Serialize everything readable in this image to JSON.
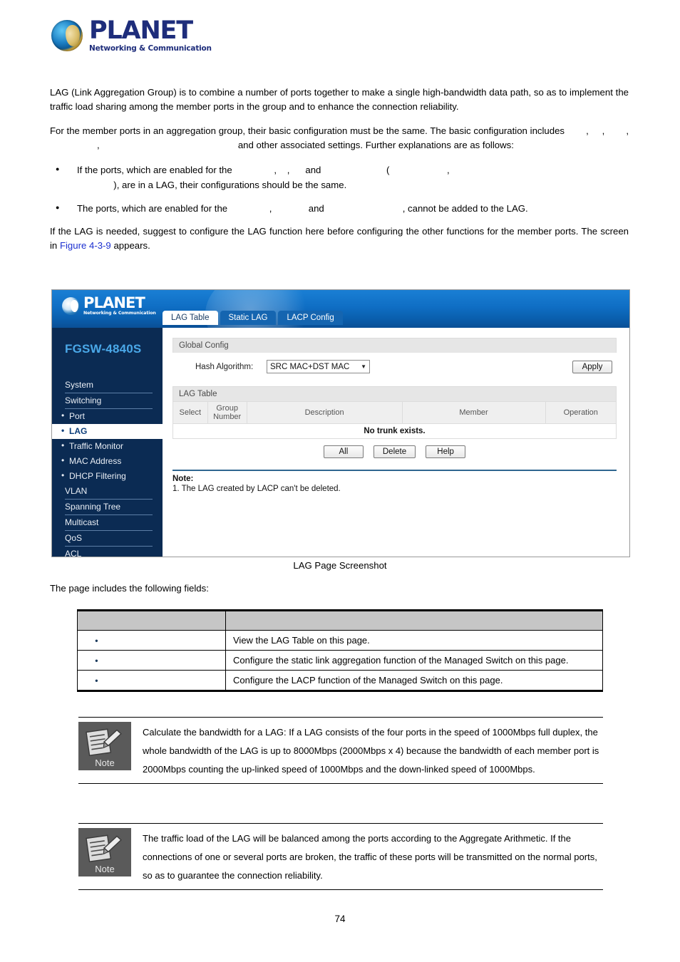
{
  "brand": {
    "name": "PLANET",
    "tagline": "Networking & Communication"
  },
  "intro": {
    "para1": "LAG (Link Aggregation Group) is to combine a number of ports together to make a single high-bandwidth data path, so as to implement the traffic load sharing among the member ports in the group and to enhance the connection reliability.",
    "para2_a": "For the member ports in an aggregation group, their basic configuration must be the same. The basic configuration includes",
    "para2_sep1": ",",
    "para2_sep2": ",",
    "para2_sep3": ",",
    "para2_sep4": ",",
    "para2_b": "and other associated settings. Further explanations are as follows:",
    "bullet1_a": "If the ports, which are enabled for the",
    "bullet1_sep1": ",",
    "bullet1_sep2": ",",
    "bullet1_and": "and",
    "bullet1_paren_open": "(",
    "bullet1_sep3": ",",
    "bullet1_paren_close": "),",
    "bullet1_b": "are in a LAG, their configurations should be the same.",
    "bullet2_a": "The ports, which are enabled for the",
    "bullet2_sep1": ",",
    "bullet2_and": "and",
    "bullet2_sep2": ",",
    "bullet2_b": "cannot be added to the LAG.",
    "para3_a": "If the LAG is needed, suggest to configure the LAG function here before configuring the other functions for the member ports. The screen in",
    "para3_link": "Figure 4-3-9",
    "para3_b": "appears."
  },
  "screenshot": {
    "model": "FGSW-4840S",
    "tabs": [
      {
        "label": "LAG Table",
        "active": true
      },
      {
        "label": "Static LAG",
        "active": false
      },
      {
        "label": "LACP Config",
        "active": false
      }
    ],
    "sidebar": [
      {
        "label": "System",
        "type": "top",
        "active": false
      },
      {
        "label": "Switching",
        "type": "top",
        "active": false
      },
      {
        "label": "Port",
        "type": "sub",
        "active": false
      },
      {
        "label": "LAG",
        "type": "sub",
        "active": true
      },
      {
        "label": "Traffic Monitor",
        "type": "sub",
        "active": false
      },
      {
        "label": "MAC Address",
        "type": "sub",
        "active": false
      },
      {
        "label": "DHCP Filtering",
        "type": "sub",
        "active": false
      },
      {
        "label": "VLAN",
        "type": "top",
        "active": false
      },
      {
        "label": "Spanning Tree",
        "type": "top",
        "active": false
      },
      {
        "label": "Multicast",
        "type": "top",
        "active": false
      },
      {
        "label": "QoS",
        "type": "top",
        "active": false
      },
      {
        "label": "ACL",
        "type": "top",
        "active": false
      }
    ],
    "global_config": {
      "title": "Global Config",
      "hash_label": "Hash Algorithm:",
      "hash_value": "SRC MAC+DST MAC",
      "caret": "▼",
      "apply_label": "Apply"
    },
    "lag_table": {
      "title": "LAG Table",
      "columns": [
        "Select",
        "Group Number",
        "Description",
        "Member",
        "Operation"
      ],
      "col_group_line1": "Group",
      "col_group_line2": "Number",
      "empty_text": "No trunk exists.",
      "buttons": [
        "All",
        "Delete",
        "Help"
      ]
    },
    "note": {
      "title": "Note:",
      "line1": "1. The LAG created by LACP can't be deleted."
    }
  },
  "caption": "LAG Page Screenshot",
  "lead_in": "The page includes the following fields:",
  "fields_table": {
    "headers": [
      "",
      ""
    ],
    "rows": [
      {
        "name": "",
        "desc": "View the LAG Table on this page."
      },
      {
        "name": "",
        "desc": "Configure the static link aggregation function of the Managed Switch on this page."
      },
      {
        "name": "",
        "desc": "Configure the LACP function of the Managed Switch on this page."
      }
    ]
  },
  "notes": [
    {
      "icon_word": "Note",
      "text": "Calculate the bandwidth for a LAG: If a LAG consists of the four ports in the speed of 1000Mbps full duplex, the whole bandwidth of the LAG is up to 8000Mbps (2000Mbps x 4) because the bandwidth of each member port is 2000Mbps counting the up-linked speed of 1000Mbps and the down-linked speed of 1000Mbps."
    },
    {
      "icon_word": "Note",
      "text": "The traffic load of the LAG will be balanced among the ports according to the Aggregate Arithmetic. If the connections of one or several ports are broken, the traffic of these ports will be transmitted on the normal ports, so as to guarantee the connection reliability."
    }
  ],
  "page_number": "74",
  "colors": {
    "link": "#1b2fd0",
    "banner_blue": "#0f6ec4",
    "sidebar_navy": "#0b2b53",
    "model_blue": "#4aa8e8",
    "note_icon_gray": "#5a5a5a"
  }
}
